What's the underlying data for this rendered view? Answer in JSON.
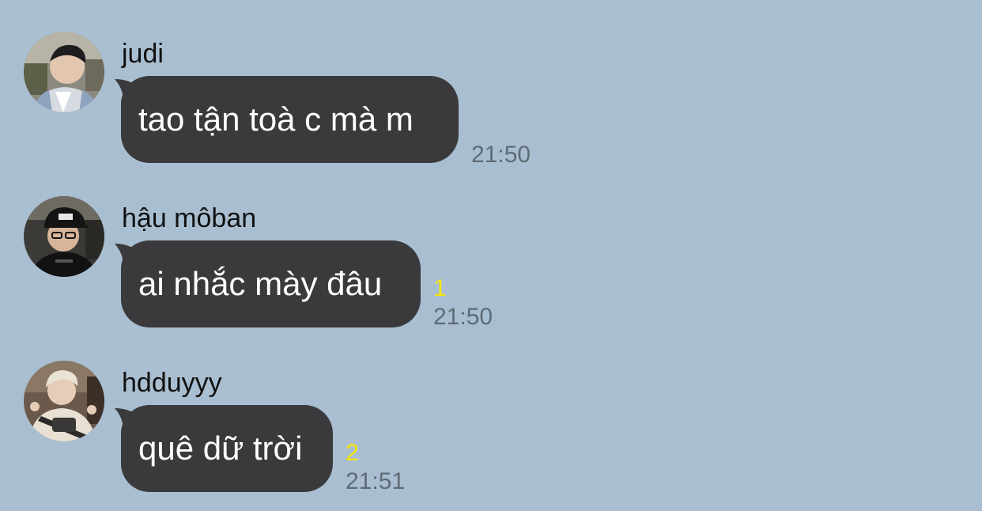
{
  "messages": [
    {
      "sender": "judi",
      "text": "tao tận toà c mà m",
      "unread": "",
      "time": "21:50",
      "avatar_icon": "user-avatar-icon"
    },
    {
      "sender": "hậu môban",
      "text": "ai nhắc mày đâu",
      "unread": "1",
      "time": "21:50",
      "avatar_icon": "user-avatar-icon"
    },
    {
      "sender": "hdduyyy",
      "text": "quê dữ trời",
      "unread": "2",
      "time": "21:51",
      "avatar_icon": "user-avatar-icon"
    }
  ],
  "colors": {
    "background": "#a9bfd1",
    "bubble": "#3a3a3c",
    "bubble_text": "#ffffff",
    "unread": "#f7e600",
    "time": "#5f6b76"
  }
}
